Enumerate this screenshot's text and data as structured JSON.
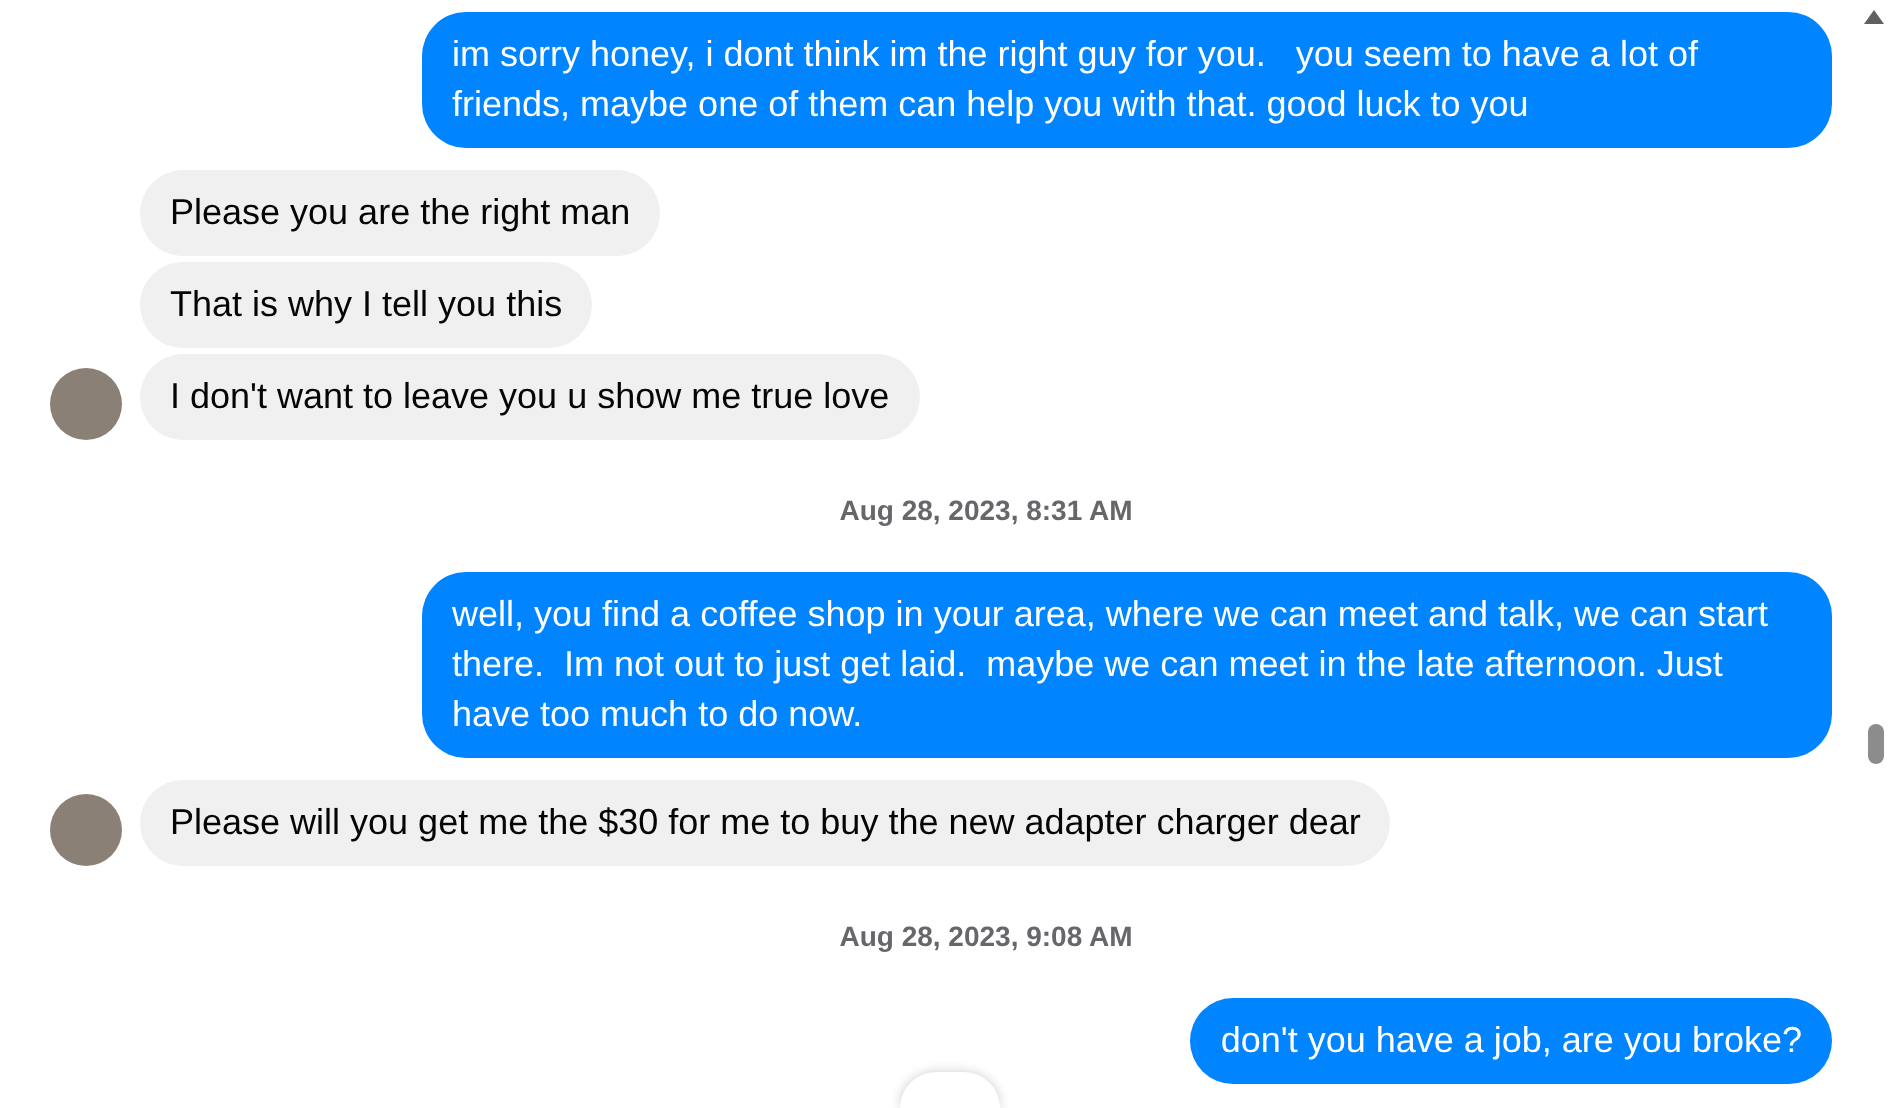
{
  "messages": [
    {
      "kind": "sent",
      "text": "im sorry honey, i dont think im the right guy for you.   you seem to have a lot of friends, maybe one of them can help you with that. good luck to you"
    },
    {
      "kind": "received",
      "text": "Please you are the right man",
      "avatar": false
    },
    {
      "kind": "received",
      "text": "That is why I tell you this",
      "avatar": false
    },
    {
      "kind": "received",
      "text": "I don't want to leave you u show me true love",
      "avatar": true
    },
    {
      "kind": "timestamp",
      "text": "Aug 28, 2023, 8:31 AM"
    },
    {
      "kind": "sent",
      "text": "well, you find a coffee shop in your area, where we can meet and talk, we can start there.  Im not out to just get laid.  maybe we can meet in the late afternoon. Just have too much to do now."
    },
    {
      "kind": "received",
      "text": "Please will you get me the $30 for me to buy the new adapter charger dear",
      "avatar": true
    },
    {
      "kind": "timestamp",
      "text": "Aug 28, 2023, 9:08 AM"
    },
    {
      "kind": "sent",
      "text": "don't you have a job, are you broke?"
    }
  ]
}
